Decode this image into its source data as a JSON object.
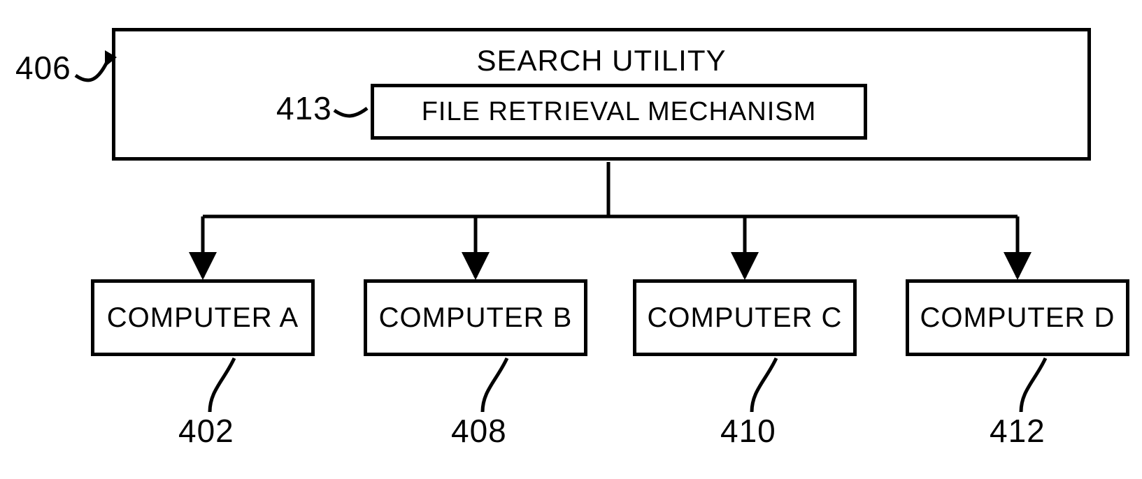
{
  "labels": {
    "l406": "406",
    "l413": "413",
    "l402": "402",
    "l408": "408",
    "l410": "410",
    "l412": "412"
  },
  "boxes": {
    "searchUtility": "SEARCH UTILITY",
    "fileRetrieval": "FILE RETRIEVAL MECHANISM",
    "compA": "COMPUTER A",
    "compB": "COMPUTER B",
    "compC": "COMPUTER C",
    "compD": "COMPUTER D"
  }
}
